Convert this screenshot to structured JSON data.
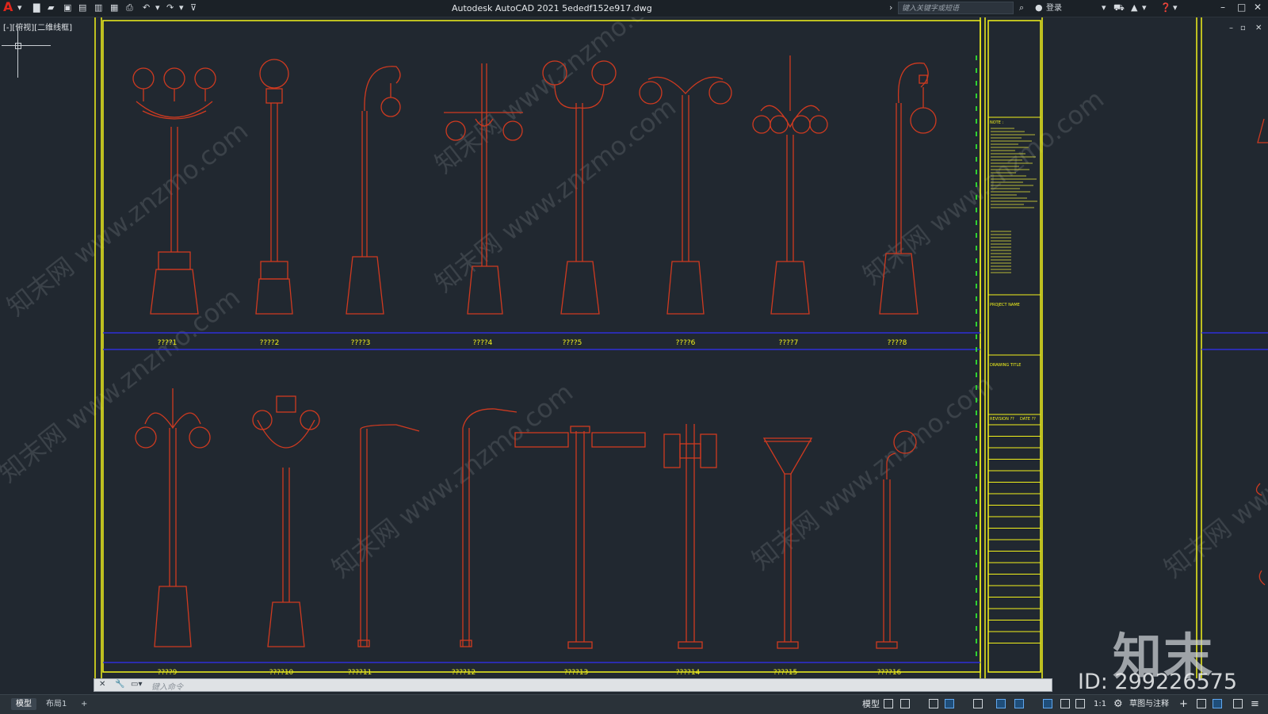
{
  "title_bar": {
    "app_title": "Autodesk AutoCAD 2021    5ededf152e917.dwg",
    "search_placeholder": "键入关键字或短语",
    "login_label": "登录",
    "app_logo": "A"
  },
  "viewport": {
    "label": "[-][俯视][二维线框]"
  },
  "lamps_row1": [
    "????1",
    "????2",
    "????3",
    "????4",
    "????5",
    "????6",
    "????7",
    "????8"
  ],
  "lamps_row2": [
    "????9",
    "????10",
    "????11",
    "????12",
    "????13",
    "????14",
    "????15",
    "????16"
  ],
  "title_block": {
    "note_header": "NOTE :",
    "project_name": "PROJECT NAME",
    "drawing_title": "DRAWING TITLE",
    "revision": "REVISION ??",
    "date": "DATE ??"
  },
  "command_line": {
    "placeholder": "键入命令"
  },
  "status_bar": {
    "tabs": [
      "模型",
      "布局1",
      "+"
    ],
    "model_label": "模型",
    "scale": "1:1",
    "workspace": "草图与注释"
  },
  "watermark": {
    "brand": "知末",
    "id": "ID: 299226575",
    "diagonal_text": "知末网 www.znzmo.com"
  },
  "colors": {
    "lamp_stroke": "#cf3a20",
    "frame_yellow": "#f2f21b",
    "rail_blue": "#2f2fd8",
    "background": "#212830"
  }
}
